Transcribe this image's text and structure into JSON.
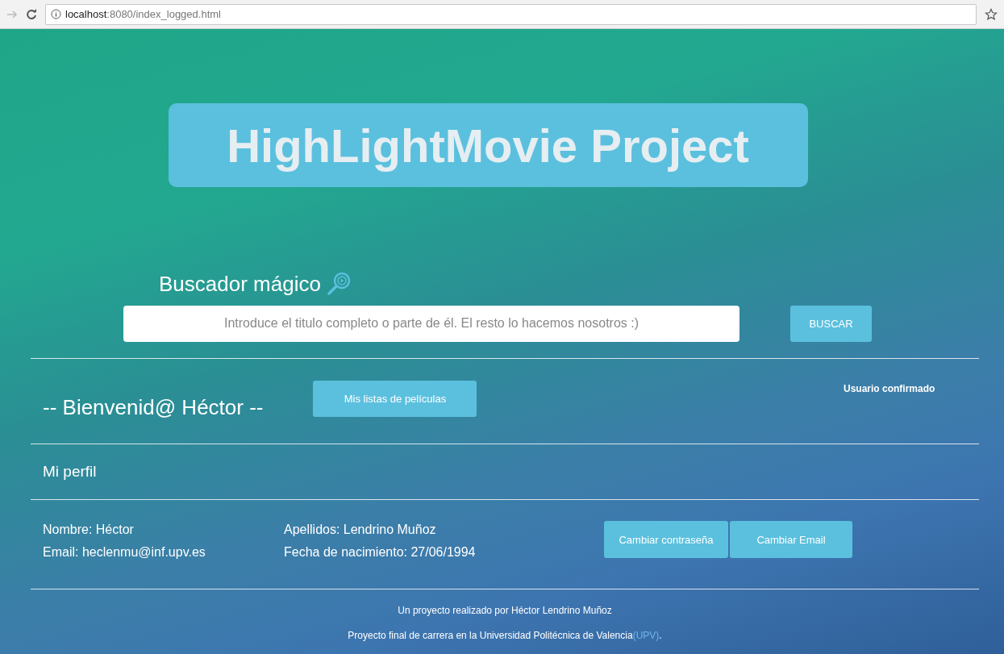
{
  "browser": {
    "url_host": "localhost",
    "url_path": ":8080/index_logged.html"
  },
  "title": "HighLightMovie Project",
  "search": {
    "label": "Buscador mágico",
    "placeholder": "Introduce el titulo completo o parte de él. El resto lo hacemos nosotros :)",
    "button": "BUSCAR"
  },
  "welcome": {
    "greeting": "-- Bienvenid@ Héctor --",
    "lists_button": "Mis listas de películas",
    "status": "Usuario confirmado"
  },
  "profile": {
    "heading": "Mi perfil",
    "fields": [
      {
        "text": "Nombre: Héctor"
      },
      {
        "text": "Email: heclenmu@inf.upv.es"
      },
      {
        "text": "Apellidos: Lendrino Muñoz"
      },
      {
        "text": "Fecha de nacimiento: 27/06/1994"
      }
    ],
    "buttons": [
      "Cambiar contraseña",
      "Cambiar Email"
    ]
  },
  "footer": {
    "credit": "Un proyecto realizado por Héctor Lendrino Muñoz",
    "note": "Proyecto final de carrera en la Universidad Politécnica de Valencia",
    "link": "(UPV)",
    "end": "."
  }
}
